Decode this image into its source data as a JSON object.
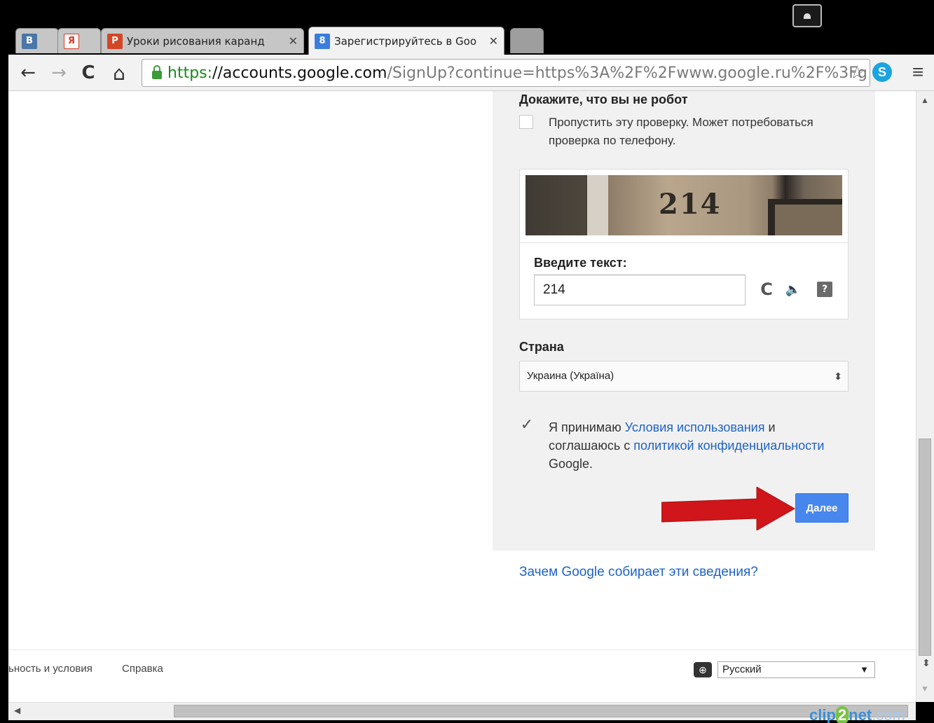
{
  "tabs": [
    {
      "favicon": "В",
      "favicon_color": "#4a76a8",
      "title": ""
    },
    {
      "favicon": "Я",
      "favicon_color": "#d33b2c",
      "title": ""
    },
    {
      "favicon": "P",
      "favicon_color": "#d24726",
      "title": "Уроки рисования каранд",
      "close": "✕"
    },
    {
      "favicon": "8",
      "favicon_color": "#3b7ddd",
      "title": "Зарегистрируйтесь в Goo",
      "close": "✕"
    }
  ],
  "toolbar": {
    "back": "←",
    "forward": "→",
    "reload": "C",
    "home": "⌂",
    "url_scheme": "https:",
    "url_host": "//accounts.google.com",
    "url_rest": "/SignUp?continue=https%3A%2F%2Fwww.google.ru%2F%3Fg",
    "star": "☆",
    "skype": "S",
    "menu": "≡"
  },
  "form": {
    "robot_title": "Докажите, что вы не робот",
    "skip_text": "Пропустить эту проверку. Может потребоваться проверка по телефону.",
    "captcha_image_text": "214",
    "captcha_label": "Введите текст:",
    "captcha_value": "214",
    "refresh_icon": "C",
    "audio_icon": "🔈",
    "help_icon": "?",
    "country_label": "Страна",
    "country_value": "Украина (Україна)",
    "select_arrows": "⬍",
    "terms_checkmark": "✓",
    "terms_pre": "Я принимаю ",
    "terms_link": "Условия использования",
    "terms_mid": " и соглашаюсь с ",
    "privacy_link": "политикой конфиденциальности",
    "terms_post": " Google.",
    "next_button": "Далее"
  },
  "why_link": "Зачем Google собирает эти сведения?",
  "footer": {
    "privacy": "ьность и условия",
    "help": "Справка",
    "lang_icon": "⊕",
    "language": "Русский",
    "lang_caret": "▼"
  },
  "scrollbars": {
    "up": "▲",
    "down": "▼",
    "sort": "⬍",
    "left": "◀"
  },
  "watermark": {
    "pre": "clip",
    "mid": "2",
    "post": "net",
    "suffix": ".com"
  },
  "colors": {
    "link": "#1e62c6",
    "next_button": "#4787ed",
    "arrow": "#d0161a"
  }
}
